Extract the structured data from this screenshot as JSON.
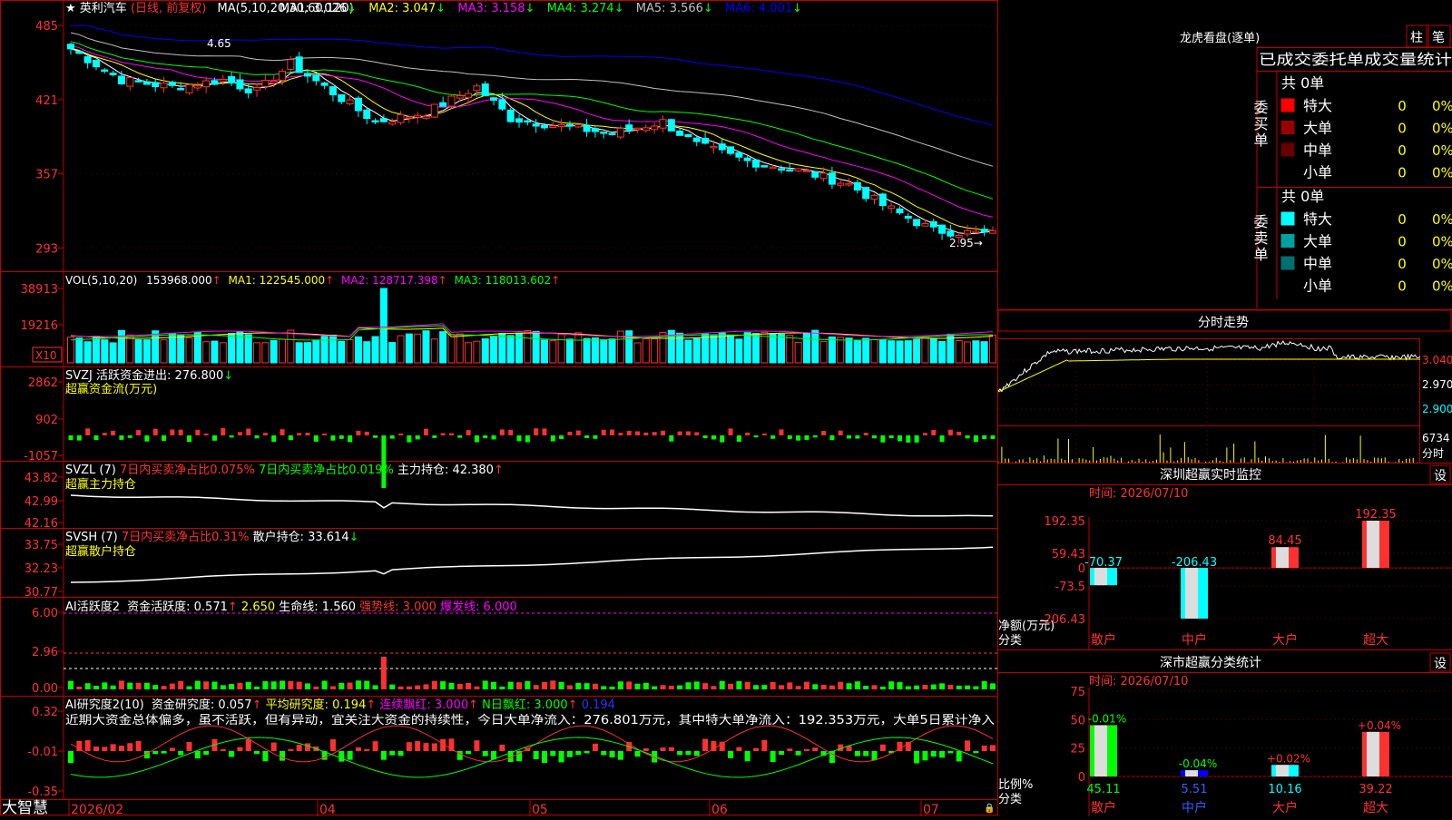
{
  "colors": {
    "up": "#ff3030",
    "down": "#00ffff",
    "grid": "#c00000",
    "ma1": "#ffffff",
    "ma2": "#ffff00",
    "ma3": "#ff00ff",
    "ma4": "#00ff00",
    "ma5": "#c0c0c0",
    "ma6": "#0000ff"
  },
  "header": {
    "star": "★",
    "stock_name": "英利汽车",
    "period": "(日线, 前复权)",
    "ma_params": "MA(5,10,20,30,60,120)",
    "ma": [
      {
        "label": "MA1: 3.026",
        "arrow": "↓",
        "color": "#ffffff"
      },
      {
        "label": "MA2: 3.047",
        "arrow": "↓",
        "color": "#ffff00"
      },
      {
        "label": "MA3: 3.158",
        "arrow": "↓",
        "color": "#ff00ff"
      },
      {
        "label": "MA4: 3.274",
        "arrow": "↓",
        "color": "#00ff00"
      },
      {
        "label": "MA5: 3.566",
        "arrow": "↓",
        "color": "#c0c0c0"
      },
      {
        "label": "MA6: 4.001",
        "arrow": "↓",
        "color": "#0000ff"
      }
    ]
  },
  "price_panel": {
    "y_ticks": [
      "485",
      "421",
      "357",
      "293"
    ],
    "high_note": "4.65",
    "low_note": "2.95"
  },
  "vol_panel": {
    "title": "VOL(5,10,20)",
    "value": "153968.000",
    "ma1": "MA1: 122545.000",
    "ma2": "MA2: 128717.398",
    "ma3": "MA3: 118013.602",
    "arrow": "↑",
    "y_ticks": [
      "38913",
      "19216"
    ],
    "unit": "X10"
  },
  "svzj_panel": {
    "title": "SVZJ  活跃资金进出: 276.800",
    "arrow": "↓",
    "subtitle": "超赢资金流(万元)",
    "y_ticks": [
      "2862",
      "902",
      "-1057"
    ]
  },
  "svzl_panel": {
    "title": "SVZL (7)",
    "text1": "7日内买卖净占比0.075%",
    "text2": "7日内买卖净占比0.019%",
    "text3": "主力持仓: 42.380",
    "arrow": "↑",
    "subtitle": "超赢主力持仓",
    "y_ticks": [
      "43.82",
      "42.99",
      "42.16"
    ]
  },
  "svsh_panel": {
    "title": "SVSH (7)",
    "text1": "7日内买卖净占比0.31%",
    "text2": "散户持仓: 33.614",
    "arrow": "↓",
    "subtitle": "超赢散户持仓",
    "y_ticks": [
      "33.75",
      "32.23",
      "30.77"
    ]
  },
  "ai_active_panel": {
    "title": "AI活跃度2",
    "text1": "资金活跃度: 0.571",
    "text2": "2.650",
    "text3": "生命线: 1.560",
    "text4": "强势线: 3.000",
    "text5": "爆发线: 6.000",
    "y_ticks": [
      "6.00",
      "2.96",
      "0.00"
    ]
  },
  "ai_research_panel": {
    "title": "AI研究度2(10)",
    "text1": "资金研究度: 0.057",
    "text2": "平均研究度: 0.194",
    "text3": "连续飘红: 3.000",
    "text4": "N日飘红: 3.000",
    "text5": "0.194",
    "commentary": "近期大资金总体偏多，虽不活跃，但有异动，宜关注大资金的持续性，今日大单净流入：276.801万元，其中特大单净流入：192.353万元，大单5日累计净入",
    "y_ticks": [
      "0.32",
      "-0.01",
      "-0.35"
    ]
  },
  "date_axis": {
    "brand": "大智慧",
    "labels": [
      "2026/02",
      "04",
      "05",
      "06",
      "07"
    ]
  },
  "dragon_tiger": {
    "title": "龙虎看盘(逐单)",
    "btn_bar": "柱",
    "btn_stroke": "笔",
    "header": "已成交委托单成交量统计",
    "buy": {
      "side_label": "委买单",
      "total": "共 0单",
      "rows": [
        {
          "label": "特大",
          "count": "0",
          "pct": "0%",
          "color": "#ff0000"
        },
        {
          "label": "大单",
          "count": "0",
          "pct": "0%",
          "color": "#990000"
        },
        {
          "label": "中单",
          "count": "0",
          "pct": "0%",
          "color": "#660000"
        },
        {
          "label": "小单",
          "count": "0",
          "pct": "0%",
          "color": "#000000"
        }
      ]
    },
    "sell": {
      "side_label": "委卖单",
      "total": "共 0单",
      "rows": [
        {
          "label": "特大",
          "count": "0",
          "pct": "0%",
          "color": "#00ffff"
        },
        {
          "label": "大单",
          "count": "0",
          "pct": "0%",
          "color": "#00a0a0"
        },
        {
          "label": "中单",
          "count": "0",
          "pct": "0%",
          "color": "#007070"
        },
        {
          "label": "小单",
          "count": "0",
          "pct": "0%",
          "color": "#000000"
        }
      ]
    }
  },
  "intraday": {
    "title": "分时走势",
    "y_ticks": [
      "3.040",
      "2.970",
      "2.900"
    ],
    "vol_label": "6734",
    "unit": "分时"
  },
  "realtime_monitor": {
    "title": "深圳超赢实时监控",
    "set_btn": "设",
    "time": "时间: 2026/07/10",
    "y_ticks": [
      "192.35",
      "59.43",
      "0",
      "-73.5",
      "-206.43"
    ],
    "y_label": "净额(万元)",
    "x_title": "分类"
  },
  "class_stats": {
    "title": "深市超赢分类统计",
    "set_btn": "设",
    "time": "时间: 2026/07/10",
    "y_ticks": [
      "75",
      "50",
      "25",
      "0"
    ],
    "y_label": "比例%",
    "x_title": "分类"
  },
  "chart_data": [
    {
      "type": "bar",
      "title": "深圳超赢实时监控",
      "categories": [
        "散户",
        "中户",
        "大户",
        "超大"
      ],
      "values": [
        -70.37,
        -206.43,
        84.45,
        192.35
      ],
      "value_labels": [
        "-70.37",
        "-206.43",
        "84.45",
        "192.35"
      ],
      "ylim": [
        -206.43,
        192.35
      ],
      "ylabel": "净额(万元)",
      "xlabel": "分类"
    },
    {
      "type": "bar",
      "title": "深市超赢分类统计",
      "categories": [
        "散户",
        "中户",
        "大户",
        "超大"
      ],
      "values": [
        45.11,
        5.51,
        10.16,
        39.22
      ],
      "value_labels": [
        "45.11",
        "5.51",
        "10.16",
        "39.22"
      ],
      "change_labels": [
        "-0.01%",
        "-0.04%",
        "+0.02%",
        "+0.04%"
      ],
      "ylim": [
        0,
        75
      ],
      "ylabel": "比例%",
      "xlabel": "分类"
    },
    {
      "type": "line",
      "title": "英利汽车 (日线, 前复权)",
      "y_range_from_ticks": [
        293,
        485
      ],
      "high_label": "4.65",
      "low_label": "2.95",
      "x_labels": [
        "2026/02",
        "04",
        "05",
        "06",
        "07"
      ],
      "series": [
        {
          "name": "MA1: 3.026"
        },
        {
          "name": "MA2: 3.047"
        },
        {
          "name": "MA3: 3.158"
        },
        {
          "name": "MA4: 3.274"
        },
        {
          "name": "MA5: 3.566"
        },
        {
          "name": "MA6: 4.001"
        }
      ]
    }
  ]
}
